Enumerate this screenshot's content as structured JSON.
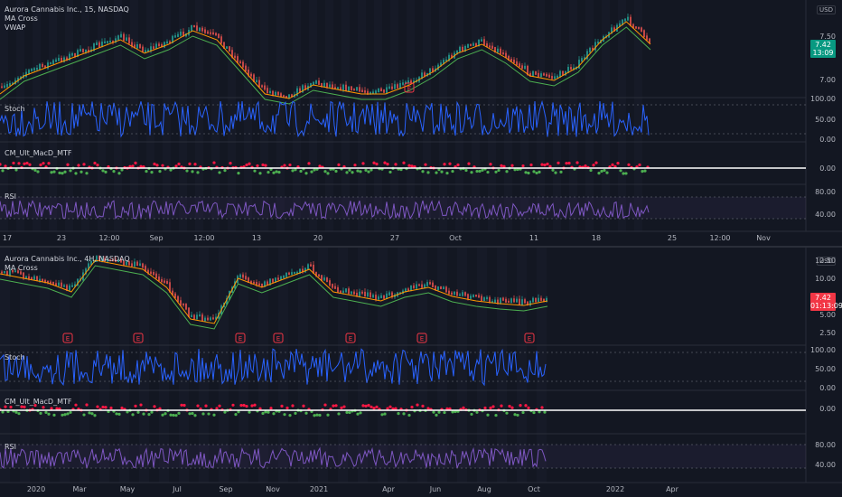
{
  "colors": {
    "bg": "#131722",
    "up": "#26a69a",
    "down": "#ef5350",
    "stoch": "#2962ff",
    "rsi": "#7e57c2",
    "macd_up": "#4caf50",
    "macd_down": "#ff1744",
    "ma": "#ff9800",
    "vwap": "#4caf50",
    "earnings": "#f23645",
    "price_tag_top": "#089981",
    "price_tag_bottom": "#f23645"
  },
  "top": {
    "legend": [
      "Aurora Cannabis Inc., 15, NASDAQ",
      "MA Cross",
      "VWAP"
    ],
    "currency": "USD",
    "price_tag": "7.42",
    "price_tag_time": "13:09",
    "yaxis_price": [
      "7.50",
      "7.00"
    ],
    "panes": {
      "stoch": "Stoch",
      "macd": "CM_Ult_MacD_MTF",
      "rsi": "RSI"
    },
    "yaxis_stoch": [
      "100.00",
      "50.00",
      "0.00"
    ],
    "yaxis_macd": [
      "0.00"
    ],
    "yaxis_rsi": [
      "80.00",
      "40.00"
    ],
    "xaxis": [
      "17",
      "23",
      "12:00",
      "Sep",
      "12:00",
      "13",
      "20",
      "27",
      "Oct",
      "11",
      "18",
      "25",
      "12:00",
      "Nov"
    ],
    "earnings_marker": "E"
  },
  "bottom": {
    "legend": [
      "Aurora Cannabis Inc., 4H, NASDAQ",
      "MA Cross"
    ],
    "currency": "USD",
    "price_tag": "7.42",
    "price_tag_time": "01:13:09",
    "yaxis_price": [
      "12.50",
      "10.00",
      "5.00",
      "2.50"
    ],
    "panes": {
      "stoch": "Stoch",
      "macd": "CM_Ult_MacD_MTF",
      "rsi": "RSI"
    },
    "yaxis_stoch": [
      "100.00",
      "50.00",
      "0.00"
    ],
    "yaxis_macd": [
      "0.00"
    ],
    "yaxis_rsi": [
      "80.00",
      "40.00"
    ],
    "xaxis": [
      "2020",
      "Mar",
      "May",
      "Jul",
      "Sep",
      "Nov",
      "2021",
      "Apr",
      "Jun",
      "Aug",
      "Oct",
      "2022",
      "Apr"
    ],
    "earnings_marker": "E"
  }
}
